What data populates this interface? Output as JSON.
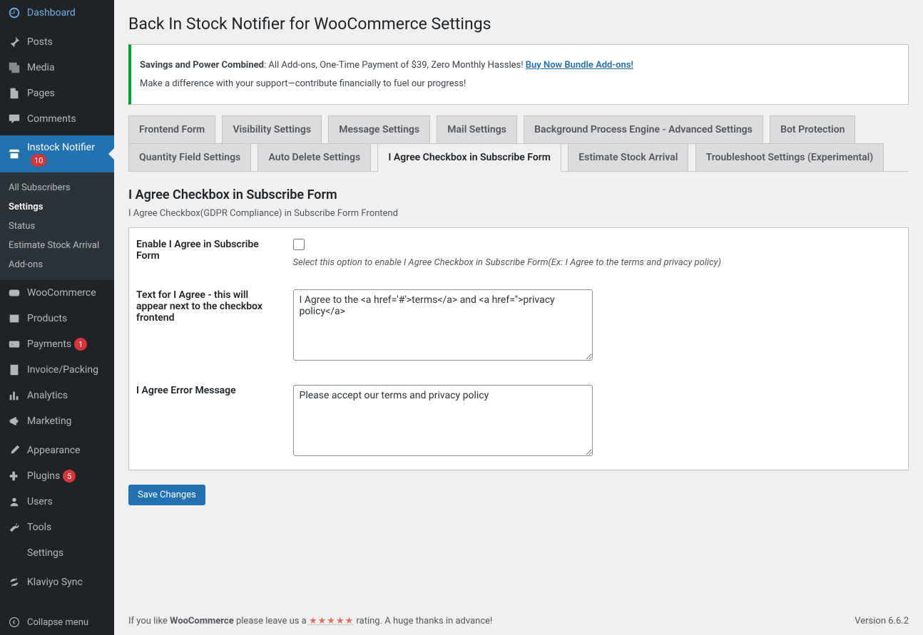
{
  "sidebar": {
    "items": [
      {
        "label": "Dashboard"
      },
      {
        "label": "Posts"
      },
      {
        "label": "Media"
      },
      {
        "label": "Pages"
      },
      {
        "label": "Comments"
      },
      {
        "label": "Instock Notifier",
        "badge": "10"
      },
      {
        "label": "WooCommerce"
      },
      {
        "label": "Products"
      },
      {
        "label": "Payments",
        "badge": "1"
      },
      {
        "label": "Invoice/Packing"
      },
      {
        "label": "Analytics"
      },
      {
        "label": "Marketing"
      },
      {
        "label": "Appearance"
      },
      {
        "label": "Plugins",
        "badge": "5"
      },
      {
        "label": "Users"
      },
      {
        "label": "Tools"
      },
      {
        "label": "Settings"
      },
      {
        "label": "Klaviyo Sync"
      }
    ],
    "submenu": [
      "All Subscribers",
      "Settings",
      "Status",
      "Estimate Stock Arrival",
      "Add-ons"
    ],
    "collapse": "Collapse menu"
  },
  "page": {
    "title": "Back In Stock Notifier for WooCommerce Settings"
  },
  "notice": {
    "strong": "Savings and Power Combined",
    "text": ": All Add-ons, One-Time Payment of $39, Zero Monthly Hassles! ",
    "link": "Buy Now Bundle Add-ons!",
    "line2": "Make a difference with your support—contribute financially to fuel our progress!"
  },
  "tabs": [
    "Frontend Form",
    "Visibility Settings",
    "Message Settings",
    "Mail Settings",
    "Background Process Engine - Advanced Settings",
    "Bot Protection",
    "Quantity Field Settings",
    "Auto Delete Settings",
    "I Agree Checkbox in Subscribe Form",
    "Estimate Stock Arrival",
    "Troubleshoot Settings (Experimental)"
  ],
  "active_tab_index": 8,
  "section": {
    "title": "I Agree Checkbox in Subscribe Form",
    "desc": "I Agree Checkbox(GDPR Compliance) in Subscribe Form Frontend"
  },
  "form": {
    "row1_label": "Enable I Agree in Subscribe Form",
    "row1_desc": "Select this option to enable I Agree Checkbox in Subscribe Form(Ex: I Agree to the terms and privacy policy)",
    "row2_label": "Text for I Agree - this will appear next to the checkbox frontend",
    "row2_value": "I Agree to the <a href='#'>terms</a> and <a href=''>privacy policy</a>",
    "row3_label": "I Agree Error Message",
    "row3_value": "Please accept our terms and privacy policy",
    "save_button": "Save Changes"
  },
  "footer": {
    "pre": "If you like ",
    "brand": "WooCommerce",
    "mid": " please leave us a ",
    "stars": "★★★★★",
    "post": " rating. A huge thanks in advance!",
    "version": "Version 6.6.2"
  }
}
